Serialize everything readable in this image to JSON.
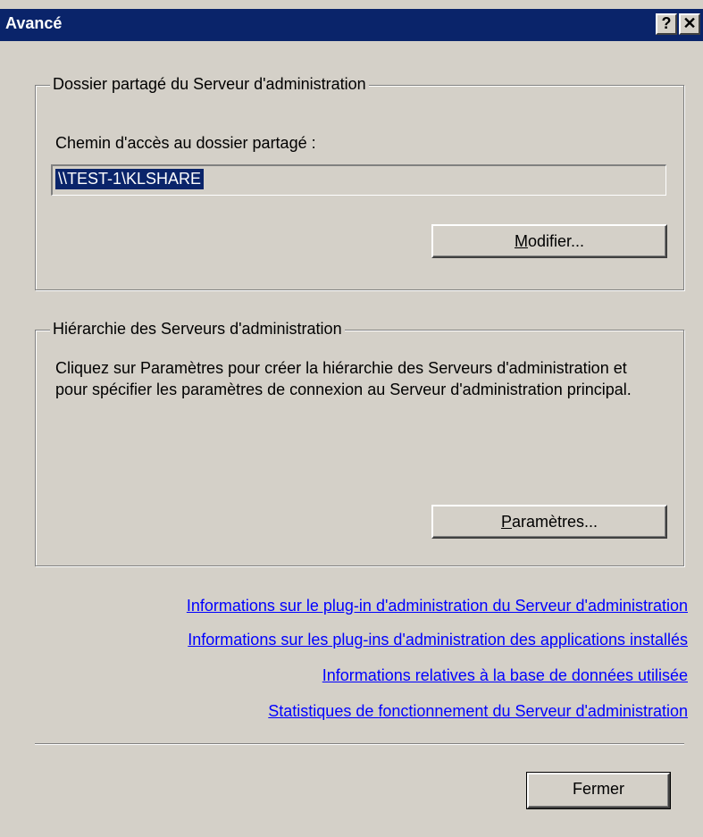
{
  "window": {
    "title": "Avancé"
  },
  "titlebar": {
    "help_symbol": "?",
    "close_symbol": "✕"
  },
  "shared_folder": {
    "legend": "Dossier partagé du Serveur d'administration",
    "path_label": "Chemin d'accès au dossier partagé :",
    "path_value": "\\\\TEST-1\\KLSHARE",
    "modify_button": {
      "mnemonic": "M",
      "rest": "odifier..."
    }
  },
  "hierarchy": {
    "legend": "Hiérarchie des Serveurs d'administration",
    "description": "Cliquez sur Paramètres pour créer la hiérarchie des Serveurs d'administration et pour spécifier les paramètres de connexion au Serveur d'administration principal.",
    "settings_button": {
      "mnemonic": "P",
      "rest": "aramètres..."
    }
  },
  "links": [
    "Informations sur le plug-in d'administration du Serveur d'administration",
    "Informations sur les plug-ins d'administration des applications installés",
    "Informations relatives à la base de données utilisée",
    "Statistiques de fonctionnement du Serveur d'administration"
  ],
  "footer": {
    "close_button": "Fermer"
  },
  "colors": {
    "face": "#d4d0c8",
    "titlebar": "#0a246a",
    "link": "#0000ff",
    "selection": "#0a246a"
  }
}
